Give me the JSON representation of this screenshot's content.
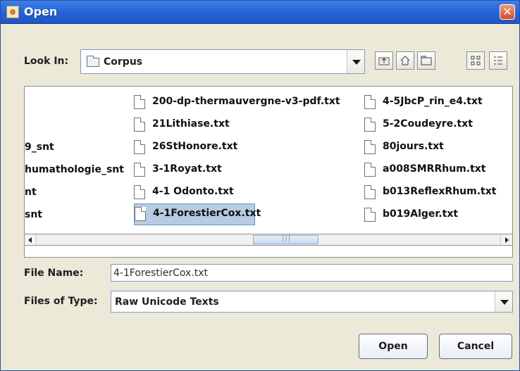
{
  "window": {
    "title": "Open"
  },
  "lookin": {
    "label": "Look In:",
    "value": "Corpus"
  },
  "toolbar": {
    "buttons": [
      {
        "name": "up-folder-icon"
      },
      {
        "name": "home-icon"
      },
      {
        "name": "new-folder-icon"
      },
      {
        "name": "list-view-icon"
      },
      {
        "name": "details-view-icon"
      }
    ]
  },
  "files": {
    "col1": [
      "9_snt",
      "humathologie_snt",
      "nt",
      "snt"
    ],
    "col2": [
      "200-dp-thermauvergne-v3-pdf.txt",
      "21Lithiase.txt",
      "26StHonore.txt",
      "3-1Royat.txt",
      "4-1 Odonto.txt",
      "4-1ForestierCox.txt"
    ],
    "col3": [
      "4-5JbcP_rin_e4.txt",
      "5-2Coudeyre.txt",
      "80jours.txt",
      "a008SMRRhum.txt",
      "b013ReflexRhum.txt",
      "b019Alger.txt"
    ]
  },
  "filename": {
    "label": "File Name:",
    "value": "4-1ForestierCox.txt"
  },
  "filetype": {
    "label": "Files of Type:",
    "value": "Raw Unicode Texts"
  },
  "buttons": {
    "open": "Open",
    "cancel": "Cancel"
  }
}
